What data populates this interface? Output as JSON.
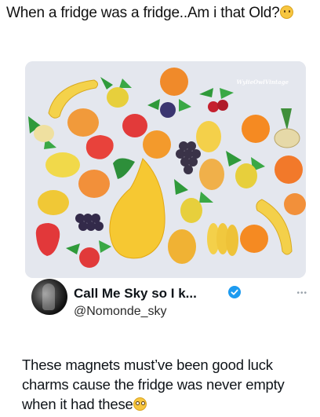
{
  "post": {
    "caption": "When a fridge was a fridge..Am i that Old?",
    "caption_emoji": "thinking-face-emoji"
  },
  "image": {
    "watermark": "WylieOwlVintage",
    "subject": "vintage-fruit-fridge-magnets"
  },
  "quoted_tweet": {
    "display_name": "Call Me Sky so I k...",
    "handle": "@Nomonde_sky",
    "verified": true,
    "verified_color": "#1d9bf0",
    "text": "These magnets must’ve been good luck charms cause the fridge was never empty when it had these",
    "text_emoji": "pleading-face-emoji"
  },
  "colors": {
    "background": "#ffffff",
    "photo_background": "#e6e8ee",
    "accent_verified": "#1d9bf0"
  }
}
